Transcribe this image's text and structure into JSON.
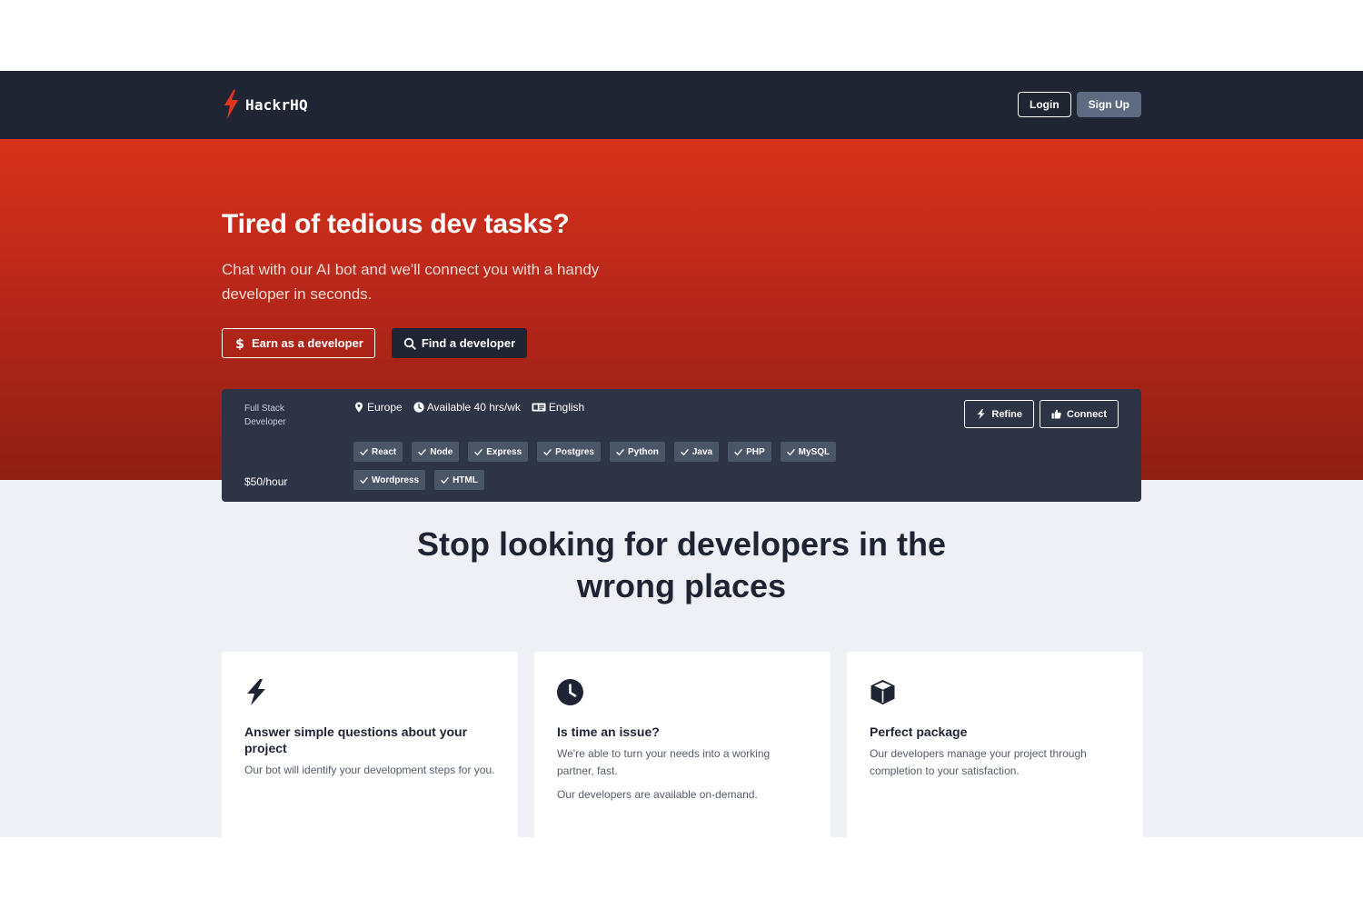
{
  "colors": {
    "nav_bg": "#1f2533",
    "hero_top": "#d8321a",
    "hero_bottom": "#8f1f14",
    "accent": "#e4361f",
    "card_bg": "#2d3446",
    "chip_bg": "#4b5568",
    "page_bg": "#eef0f5"
  },
  "nav": {
    "brand": "HackrHQ",
    "brand_icon": "lightning-icon",
    "login": "Login",
    "signup": "Sign Up"
  },
  "hero": {
    "title": "Tired of tedious dev tasks?",
    "subtitle": "Chat with our AI bot and we'll connect you with a handy developer in seconds.",
    "earn_button": "Earn as a developer",
    "earn_icon": "dollar-icon",
    "find_button": "Find a developer",
    "find_icon": "search-icon"
  },
  "developer": {
    "role": "Full Stack Developer",
    "rate": "$50/hour",
    "location": "Europe",
    "availability": "Available 40 hrs/wk",
    "language": "English",
    "skills": [
      "React",
      "Node",
      "Express",
      "Postgres",
      "Python",
      "Java",
      "PHP",
      "MySQL",
      "Wordpress",
      "HTML"
    ],
    "refine": "Refine",
    "connect": "Connect"
  },
  "section": {
    "title": "Stop looking for developers in the wrong places",
    "features": [
      {
        "icon": "lightning-icon",
        "title": "Answer simple questions about your project",
        "texts": [
          "Our bot will identify your development steps for you."
        ]
      },
      {
        "icon": "clock-icon",
        "title": "Is time an issue?",
        "texts": [
          "We're able to turn your needs into a working partner, fast.",
          "Our developers are available on-demand."
        ]
      },
      {
        "icon": "cube-icon",
        "title": "Perfect package",
        "texts": [
          "Our developers manage your project through completion to your satisfaction."
        ]
      }
    ]
  }
}
